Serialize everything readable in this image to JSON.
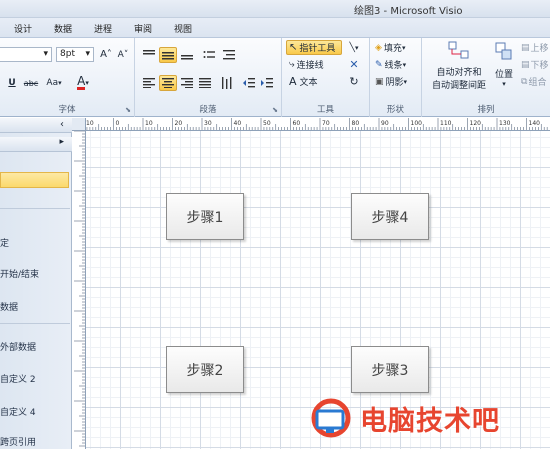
{
  "window": {
    "title": "绘图3 - Microsoft Visio"
  },
  "tabs": [
    "设计",
    "数据",
    "进程",
    "审阅",
    "视图"
  ],
  "ribbon": {
    "font": {
      "size": "8pt",
      "label": "字体",
      "grow": "A˄",
      "shrink": "A˅",
      "underline": "U",
      "strike": "abc",
      "case": "Aa",
      "color_letter": "A"
    },
    "paragraph": {
      "label": "段落"
    },
    "tools": {
      "label": "工具",
      "pointer": "指针工具",
      "connector": "连接线",
      "text": "文本",
      "pointer_color": "#d7a63c"
    },
    "shape": {
      "label": "形状",
      "fill": "填充",
      "line": "线条",
      "shadow": "阴影"
    },
    "arrange": {
      "label": "排列",
      "auto_align": "自动对齐和",
      "auto_space": "自动调整间距",
      "position": "位置",
      "up": "上移",
      "down": "下移",
      "group": "组合"
    }
  },
  "sidebar": {
    "items": [
      "定",
      "开始/结束",
      "数据",
      "外部数据",
      "自定义 2",
      "自定义 4",
      "跨页引用"
    ],
    "highlight_color": "#fbd96c"
  },
  "ruler": {
    "ticks": [
      "10",
      "0",
      "10",
      "20",
      "30",
      "40",
      "50",
      "60",
      "70",
      "80",
      "90",
      "100",
      "110",
      "120",
      "130",
      "140",
      "150"
    ]
  },
  "shapes": [
    {
      "label": "步骤1"
    },
    {
      "label": "步骤4"
    },
    {
      "label": "步骤2"
    },
    {
      "label": "步骤3"
    }
  ],
  "watermark": {
    "text": "电脑技术吧",
    "color": "#e7452f",
    "icon": "monitor-logo-icon"
  }
}
